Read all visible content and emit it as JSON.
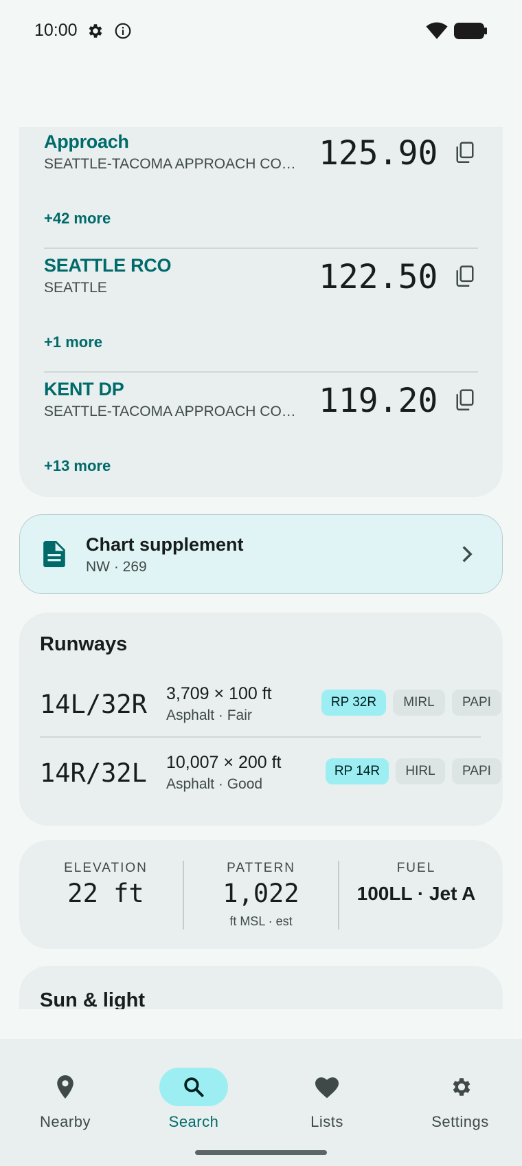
{
  "status_bar": {
    "time": "10:00",
    "icons": [
      "gear-icon",
      "info-icon",
      "wifi-icon",
      "battery-icon"
    ]
  },
  "frequencies": [
    {
      "name": "Approach",
      "description": "SEATTLE-TACOMA APPROACH CONTROL",
      "value": "125.90",
      "more": "+42 more"
    },
    {
      "name": "SEATTLE RCO",
      "description": "SEATTLE",
      "value": "122.50",
      "more": "+1 more"
    },
    {
      "name": "KENT DP",
      "description": "SEATTLE-TACOMA APPROACH CONTROL",
      "value": "119.20",
      "more": "+13 more"
    }
  ],
  "chart_supplement": {
    "title": "Chart supplement",
    "subtitle": "NW · 269"
  },
  "runways": {
    "title": "Runways",
    "items": [
      {
        "id": "14L/32R",
        "dims": "3,709 × 100 ft",
        "surface": "Asphalt · Fair",
        "chips": [
          "RP 32R",
          "MIRL",
          "PAPI"
        ]
      },
      {
        "id": "14R/32L",
        "dims": "10,007 × 200 ft",
        "surface": "Asphalt · Good",
        "chips": [
          "RP 14R",
          "HIRL",
          "PAPI"
        ]
      }
    ]
  },
  "stats": {
    "elevation": {
      "label": "ELEVATION",
      "value": "22 ft"
    },
    "pattern": {
      "label": "PATTERN",
      "value": "1,022",
      "sub": "ft MSL · est"
    },
    "fuel": {
      "label": "FUEL",
      "value": "100LL · Jet A"
    }
  },
  "sun_light": {
    "title": "Sun & light"
  },
  "nav": {
    "items": [
      {
        "label": "Nearby",
        "icon": "location-pin-icon"
      },
      {
        "label": "Search",
        "icon": "search-icon",
        "active": true
      },
      {
        "label": "Lists",
        "icon": "heart-icon"
      },
      {
        "label": "Settings",
        "icon": "gear-icon"
      }
    ]
  },
  "colors": {
    "accent": "#006a6a",
    "accent_container": "#9deef2",
    "surface": "#f3f8f7",
    "card": "#e8efee"
  }
}
